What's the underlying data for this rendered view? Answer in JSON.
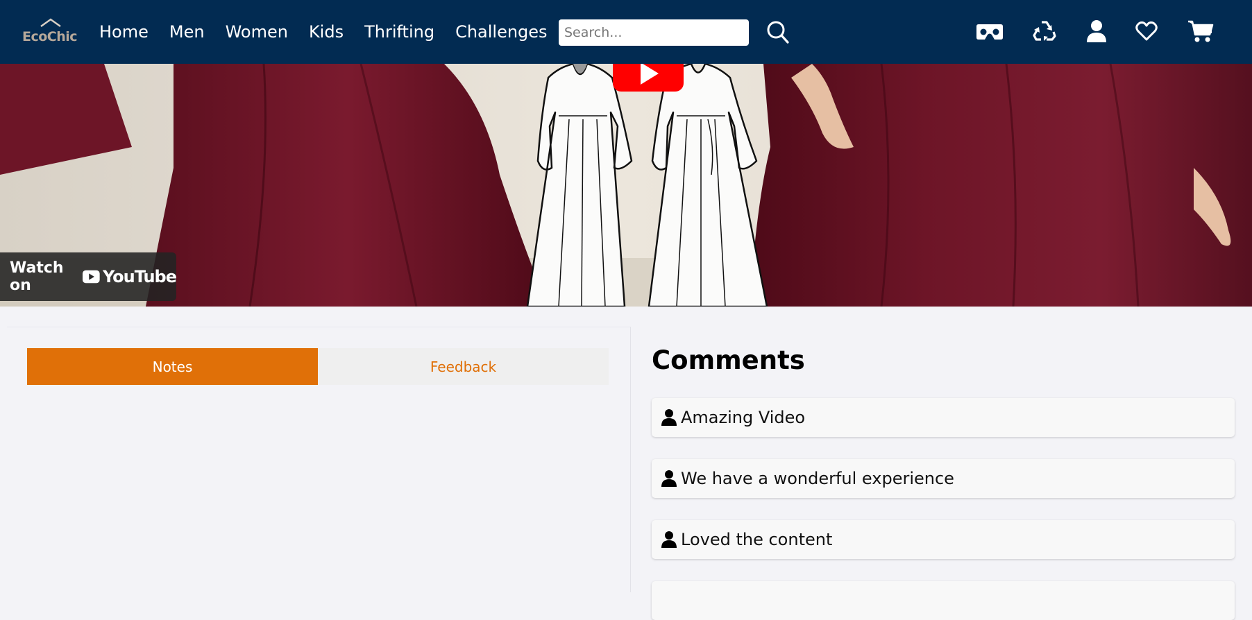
{
  "brand": {
    "name": "EcoChic",
    "primary_color": "#022b52",
    "accent_color": "#e07008"
  },
  "nav": {
    "links": [
      "Home",
      "Men",
      "Women",
      "Kids",
      "Thrifting",
      "Challenges"
    ],
    "search": {
      "placeholder": "Search...",
      "value": ""
    },
    "icons": [
      "search-icon",
      "vr-headset-icon",
      "recycle-icon",
      "user-icon",
      "heart-icon",
      "cart-icon"
    ]
  },
  "video": {
    "watch_on_label": "Watch on",
    "platform_label": "YouTube"
  },
  "tabs": {
    "notes_label": "Notes",
    "feedback_label": "Feedback",
    "active": "Notes"
  },
  "comments": {
    "title": "Comments",
    "items": [
      "Amazing Video",
      "We have a wonderful experience",
      "Loved the content"
    ]
  }
}
